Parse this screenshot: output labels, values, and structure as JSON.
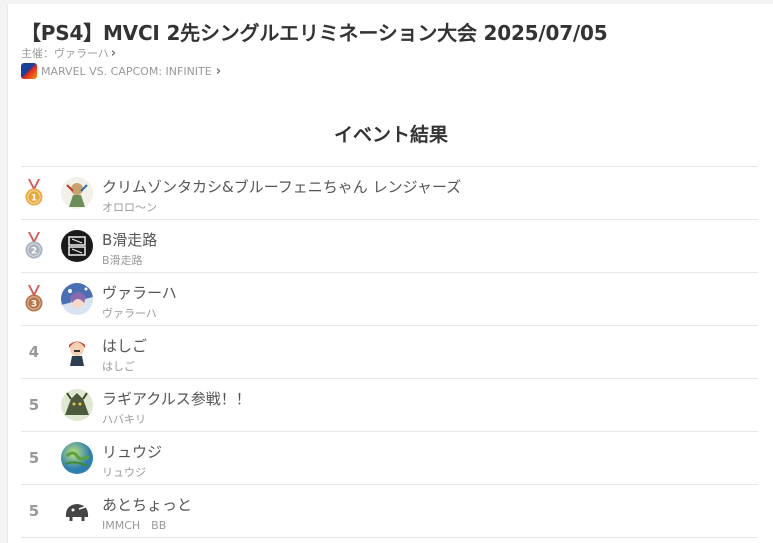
{
  "event": {
    "title": "【PS4】MVCI 2先シングルエリミネーション大会 2025/07/05",
    "organizer_label": "主催：ヴァラーハ",
    "game_name": "MARVEL VS. CAPCOM: INFINITE"
  },
  "results": {
    "heading": "イベント結果",
    "colors": {
      "gold": "#e9a93a",
      "silver": "#a9b3bd",
      "bronze": "#b87445",
      "ribbon": "#d9534f"
    },
    "entries": [
      {
        "rank": "1",
        "medal": "gold",
        "name": "クリムゾンタカシ&ブルーフェニちゃん レンジャーズ",
        "player": "オロロ〜ン",
        "avatar": "avatar-1"
      },
      {
        "rank": "2",
        "medal": "silver",
        "name": "B滑走路",
        "player": "B滑走路",
        "avatar": "avatar-2"
      },
      {
        "rank": "3",
        "medal": "bronze",
        "name": "ヴァラーハ",
        "player": "ヴァラーハ",
        "avatar": "avatar-3"
      },
      {
        "rank": "4",
        "medal": "",
        "name": "はしご",
        "player": "はしご",
        "avatar": "avatar-4"
      },
      {
        "rank": "5",
        "medal": "",
        "name": "ラギアクルス参戦！！",
        "player": "ハバキリ",
        "avatar": "avatar-5"
      },
      {
        "rank": "5",
        "medal": "",
        "name": "リュウジ",
        "player": "リュウジ",
        "avatar": "avatar-6"
      },
      {
        "rank": "5",
        "medal": "",
        "name": "あとちょっと",
        "player": "IMMCH　BB",
        "avatar": "avatar-7"
      }
    ]
  }
}
